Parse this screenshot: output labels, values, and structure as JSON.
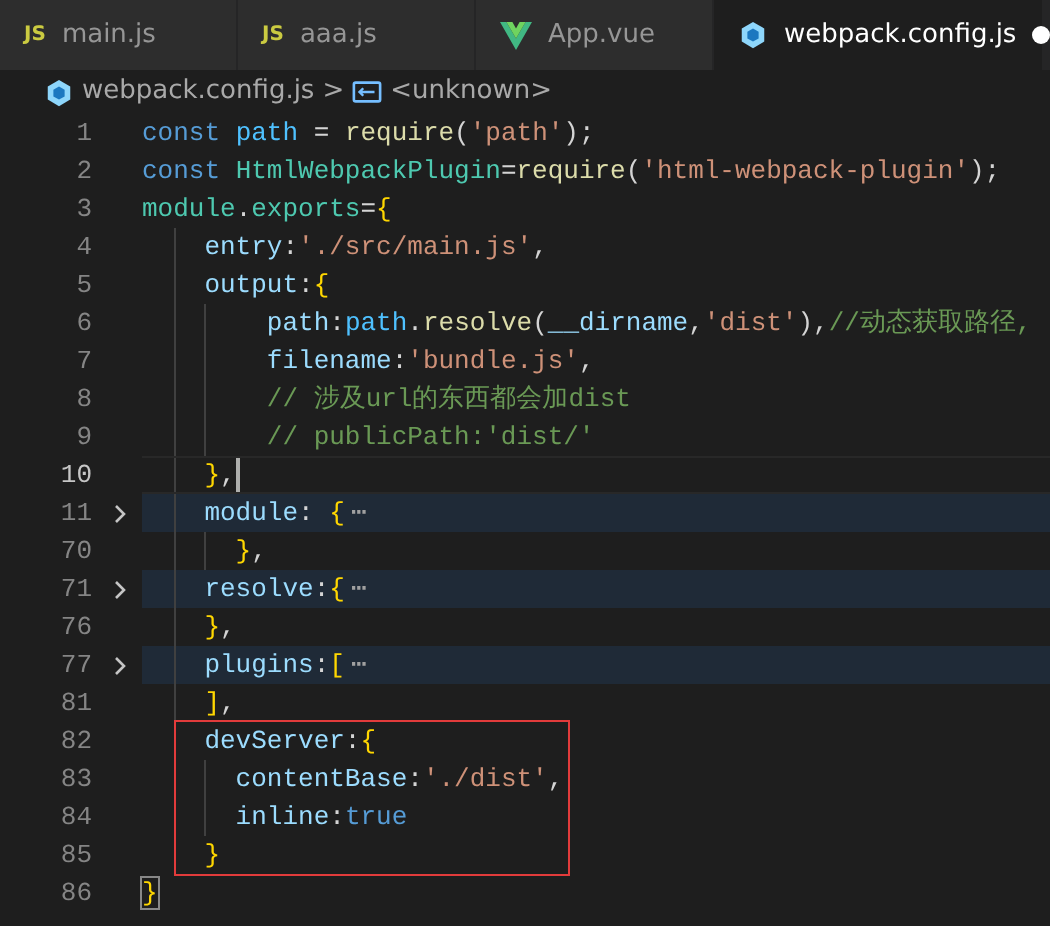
{
  "tabs": [
    {
      "kind": "js",
      "badge": "JS",
      "label": "main.js",
      "selected": false,
      "modified": false
    },
    {
      "kind": "js",
      "badge": "JS",
      "label": "aaa.js",
      "selected": false,
      "modified": false
    },
    {
      "kind": "vue",
      "label": "App.vue",
      "selected": false,
      "modified": false
    },
    {
      "kind": "webpack",
      "label": "webpack.config.js",
      "selected": true,
      "modified": true
    }
  ],
  "breadcrumb": {
    "file": "webpack.config.js",
    "separator": ">",
    "symbol": "<unknown>"
  },
  "lines": [
    {
      "number": "1",
      "tokens": [
        {
          "kind": "kw",
          "text": "const "
        },
        {
          "kind": "var",
          "text": "path"
        },
        {
          "kind": "p",
          "text": " = "
        },
        {
          "kind": "fn",
          "text": "require"
        },
        {
          "kind": "p",
          "text": "("
        },
        {
          "kind": "str",
          "text": "'path'"
        },
        {
          "kind": "p",
          "text": ");"
        }
      ]
    },
    {
      "number": "2",
      "tokens": [
        {
          "kind": "kw",
          "text": "const "
        },
        {
          "kind": "cls",
          "text": "HtmlWebpackPlugin"
        },
        {
          "kind": "p",
          "text": "="
        },
        {
          "kind": "fn",
          "text": "require"
        },
        {
          "kind": "p",
          "text": "("
        },
        {
          "kind": "str",
          "text": "'html-webpack-plugin'"
        },
        {
          "kind": "p",
          "text": ");"
        }
      ]
    },
    {
      "number": "3",
      "tokens": [
        {
          "kind": "cls",
          "text": "module"
        },
        {
          "kind": "p",
          "text": "."
        },
        {
          "kind": "cls",
          "text": "exports"
        },
        {
          "kind": "p",
          "text": "="
        },
        {
          "kind": "br",
          "text": "{"
        }
      ]
    },
    {
      "number": "4",
      "tokens": [
        {
          "kind": "prop",
          "text": "    entry"
        },
        {
          "kind": "p",
          "text": ":"
        },
        {
          "kind": "str",
          "text": "'./src/main.js'"
        },
        {
          "kind": "p",
          "text": ","
        }
      ]
    },
    {
      "number": "5",
      "tokens": [
        {
          "kind": "prop",
          "text": "    output"
        },
        {
          "kind": "p",
          "text": ":"
        },
        {
          "kind": "br",
          "text": "{"
        }
      ]
    },
    {
      "number": "6",
      "tokens": [
        {
          "kind": "prop",
          "text": "        path"
        },
        {
          "kind": "p",
          "text": ":"
        },
        {
          "kind": "var",
          "text": "path"
        },
        {
          "kind": "p",
          "text": "."
        },
        {
          "kind": "fn",
          "text": "resolve"
        },
        {
          "kind": "p",
          "text": "("
        },
        {
          "kind": "prop",
          "text": "__dirname"
        },
        {
          "kind": "p",
          "text": ","
        },
        {
          "kind": "str",
          "text": "'dist'"
        },
        {
          "kind": "p",
          "text": "),"
        },
        {
          "kind": "cm",
          "text": "//动态获取路径,"
        }
      ]
    },
    {
      "number": "7",
      "tokens": [
        {
          "kind": "prop",
          "text": "        filename"
        },
        {
          "kind": "p",
          "text": ":"
        },
        {
          "kind": "str",
          "text": "'bundle.js'"
        },
        {
          "kind": "p",
          "text": ","
        }
      ]
    },
    {
      "number": "8",
      "tokens": [
        {
          "kind": "cm",
          "text": "        // 涉及url的东西都会加dist"
        }
      ]
    },
    {
      "number": "9",
      "tokens": [
        {
          "kind": "cm",
          "text": "        // publicPath:'dist/'"
        }
      ]
    },
    {
      "number": "10",
      "current": true,
      "tokens": [
        {
          "kind": "br",
          "text": "    }"
        },
        {
          "kind": "p",
          "text": ","
        }
      ]
    },
    {
      "number": "11",
      "folded": true,
      "ellipsis": "⋯",
      "tokens": [
        {
          "kind": "prop",
          "text": "    module"
        },
        {
          "kind": "p",
          "text": ": "
        },
        {
          "kind": "br",
          "text": "{"
        }
      ]
    },
    {
      "number": "70",
      "tokens": [
        {
          "kind": "br",
          "text": "      }"
        },
        {
          "kind": "p",
          "text": ","
        }
      ]
    },
    {
      "number": "71",
      "folded": true,
      "ellipsis": "⋯",
      "tokens": [
        {
          "kind": "prop",
          "text": "    resolve"
        },
        {
          "kind": "p",
          "text": ":"
        },
        {
          "kind": "br",
          "text": "{"
        }
      ]
    },
    {
      "number": "76",
      "tokens": [
        {
          "kind": "br",
          "text": "    }"
        },
        {
          "kind": "p",
          "text": ","
        }
      ]
    },
    {
      "number": "77",
      "folded": true,
      "ellipsis": "⋯",
      "tokens": [
        {
          "kind": "prop",
          "text": "    plugins"
        },
        {
          "kind": "p",
          "text": ":"
        },
        {
          "kind": "br",
          "text": "["
        }
      ]
    },
    {
      "number": "81",
      "tokens": [
        {
          "kind": "br",
          "text": "    ]"
        },
        {
          "kind": "p",
          "text": ","
        }
      ]
    },
    {
      "number": "82",
      "framed": true,
      "tokens": [
        {
          "kind": "prop",
          "text": "    devServer"
        },
        {
          "kind": "p",
          "text": ":"
        },
        {
          "kind": "br",
          "text": "{"
        }
      ]
    },
    {
      "number": "83",
      "framed": true,
      "tokens": [
        {
          "kind": "prop",
          "text": "      contentBase"
        },
        {
          "kind": "p",
          "text": ":"
        },
        {
          "kind": "str",
          "text": "'./dist'"
        },
        {
          "kind": "p",
          "text": ","
        }
      ]
    },
    {
      "number": "84",
      "framed": true,
      "tokens": [
        {
          "kind": "prop",
          "text": "      inline"
        },
        {
          "kind": "p",
          "text": ":"
        },
        {
          "kind": "kw",
          "text": "true"
        }
      ]
    },
    {
      "number": "85",
      "framed": true,
      "tokens": [
        {
          "kind": "br",
          "text": "    }"
        }
      ]
    },
    {
      "number": "86",
      "matched": true,
      "tokens": [
        {
          "kind": "br",
          "text": "}"
        }
      ]
    }
  ]
}
